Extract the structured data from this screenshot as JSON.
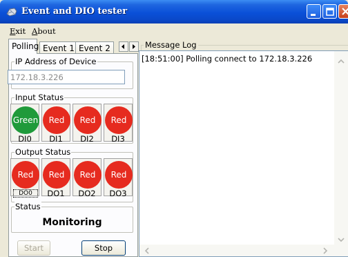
{
  "window": {
    "title": "Event and DIO tester"
  },
  "menu": {
    "exit": "Exit",
    "about": "About"
  },
  "tabs": [
    {
      "label": "Polling",
      "active": true
    },
    {
      "label": "Event 1",
      "active": false
    },
    {
      "label": "Event 2",
      "active": false
    }
  ],
  "ip_group": {
    "label": "IP Address of Device",
    "value": "172.18.3.226"
  },
  "input_status": {
    "label": "Input Status",
    "channels": [
      {
        "state": "Green",
        "name": "DI0",
        "color": "#1f9a3a"
      },
      {
        "state": "Red",
        "name": "DI1",
        "color": "#e62b1f"
      },
      {
        "state": "Red",
        "name": "DI2",
        "color": "#e62b1f"
      },
      {
        "state": "Red",
        "name": "DI3",
        "color": "#e62b1f"
      }
    ]
  },
  "output_status": {
    "label": "Output Status",
    "channels": [
      {
        "state": "Red",
        "name": "DO0",
        "color": "#e62b1f"
      },
      {
        "state": "Red",
        "name": "DO1",
        "color": "#e62b1f"
      },
      {
        "state": "Red",
        "name": "DO2",
        "color": "#e62b1f"
      },
      {
        "state": "Red",
        "name": "DO3",
        "color": "#e62b1f"
      }
    ]
  },
  "status": {
    "label": "Status",
    "value": "Monitoring"
  },
  "buttons": {
    "start": "Start",
    "stop": "Stop"
  },
  "message_log": {
    "label": "Message Log",
    "entries": [
      "[18:51:00] Polling connect to 172.18.3.226"
    ]
  }
}
